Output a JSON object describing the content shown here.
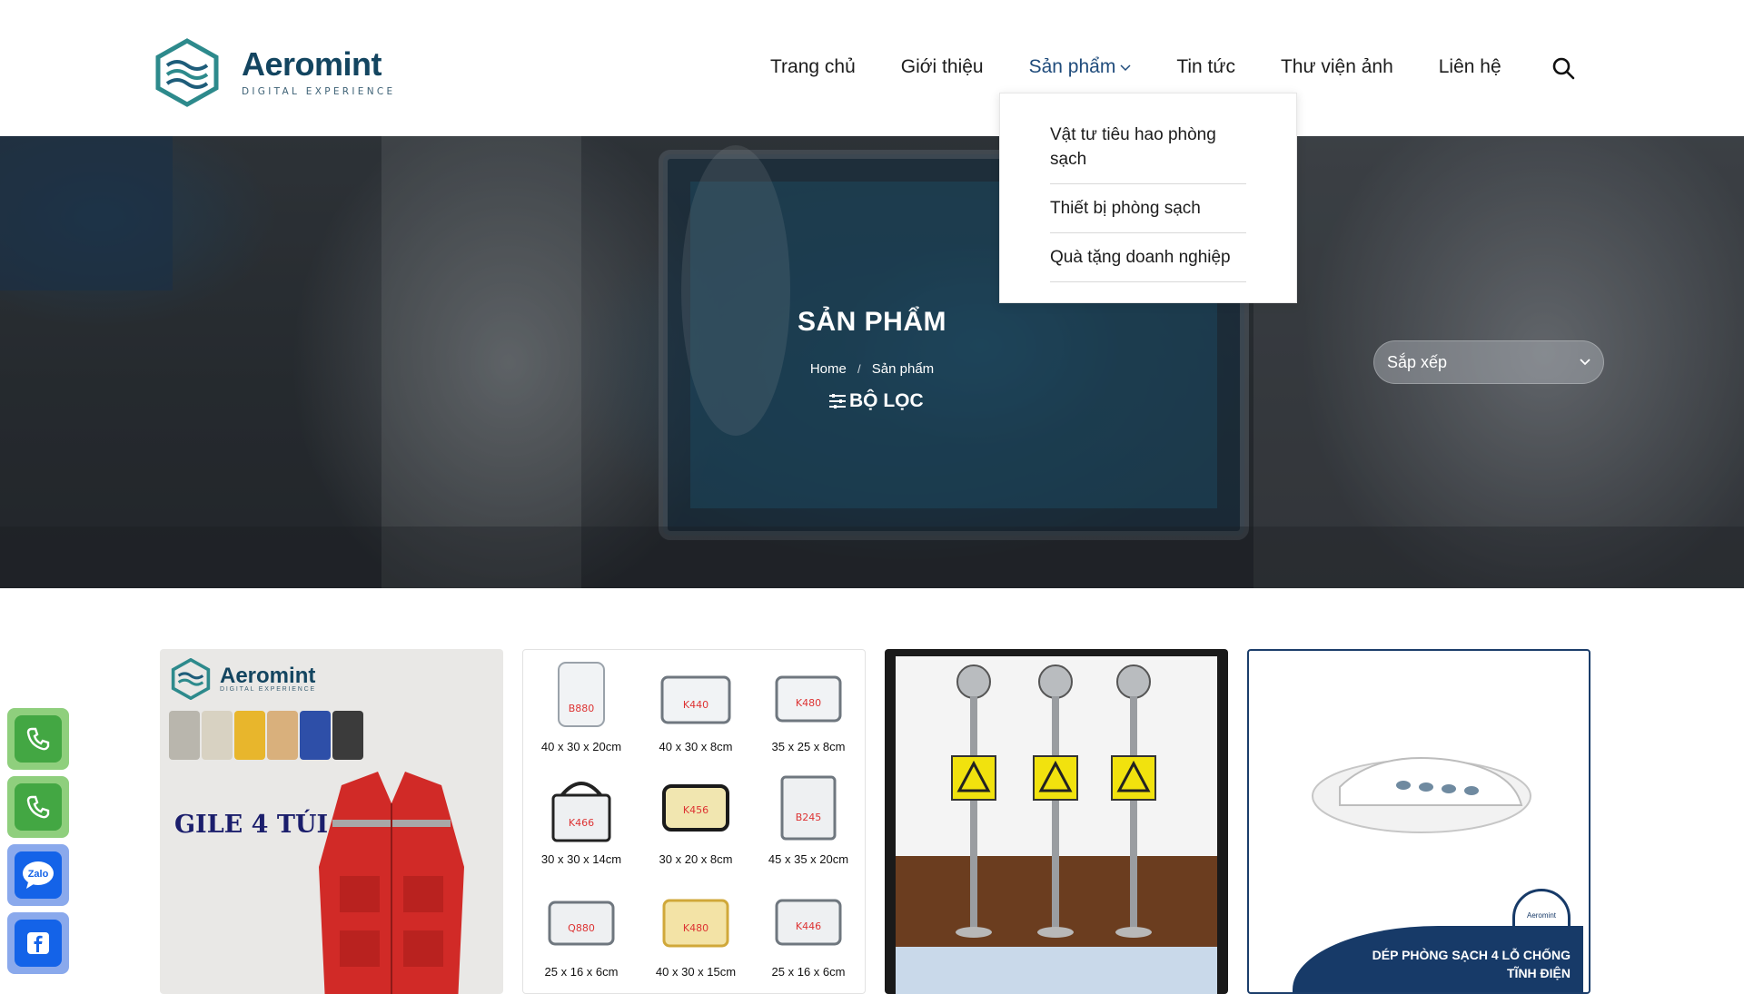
{
  "brand": {
    "name": "Aeromint",
    "tagline": "DIGITAL EXPERIENCE",
    "color": "#134560"
  },
  "nav": {
    "items": [
      {
        "label": "Trang chủ"
      },
      {
        "label": "Giới thiệu"
      },
      {
        "label": "Sản phẩm",
        "active": true
      },
      {
        "label": "Tin tức"
      },
      {
        "label": "Thư viện ảnh"
      },
      {
        "label": "Liên hệ"
      }
    ],
    "search_icon": "search-icon",
    "active_color": "#1f4b7b"
  },
  "dropdown": {
    "items": [
      {
        "label": "Vật tư tiêu hao phòng sạch"
      },
      {
        "label": "Thiết bị phòng sạch"
      },
      {
        "label": "Quà tặng doanh nghiệp"
      }
    ]
  },
  "hero": {
    "title": "SẢN PHẨM",
    "breadcrumb": {
      "home": "Home",
      "separator": "/",
      "current": "Sản phẩm"
    },
    "filter_label": "BỘ LỌC",
    "filter_icon": "sliders-icon",
    "sort": {
      "selected": "Sắp xếp",
      "icon": "chevron-down-icon"
    }
  },
  "products": {
    "card1": {
      "title": "GILE 4 TÚI",
      "brand": "Aeromint",
      "tagline": "DIGITAL EXPERIENCE"
    },
    "card2": {
      "bags": [
        {
          "code": "B880",
          "dim": "40 x 30 x 20cm"
        },
        {
          "code": "K440",
          "dim": "40 x 30 x 8cm"
        },
        {
          "code": "K480",
          "dim": "35 x 25 x 8cm"
        },
        {
          "code": "K466",
          "dim": "30 x 30 x 14cm"
        },
        {
          "code": "K456",
          "dim": "30 x 20 x 8cm"
        },
        {
          "code": "B245",
          "dim": "45 x 35 x 20cm"
        },
        {
          "code": "Q880",
          "dim": "25 x 16 x 6cm"
        },
        {
          "code": "K480",
          "dim": "40 x 30 x 15cm"
        },
        {
          "code": "K446",
          "dim": "25 x 16 x 6cm"
        }
      ]
    },
    "card4": {
      "caption_line1": "DÉP PHÒNG SẠCH 4 LỖ CHỐNG",
      "caption_line2": "TĨNH ĐIỆN",
      "badge": "Aeromint"
    }
  },
  "contacts": [
    {
      "icon": "phone-icon",
      "color": "#43a743"
    },
    {
      "icon": "phone-icon",
      "color": "#43a743"
    },
    {
      "icon": "zalo-icon",
      "label": "Zalo",
      "color": "#1463e8"
    },
    {
      "icon": "facebook-icon",
      "color": "#1463e8"
    }
  ]
}
